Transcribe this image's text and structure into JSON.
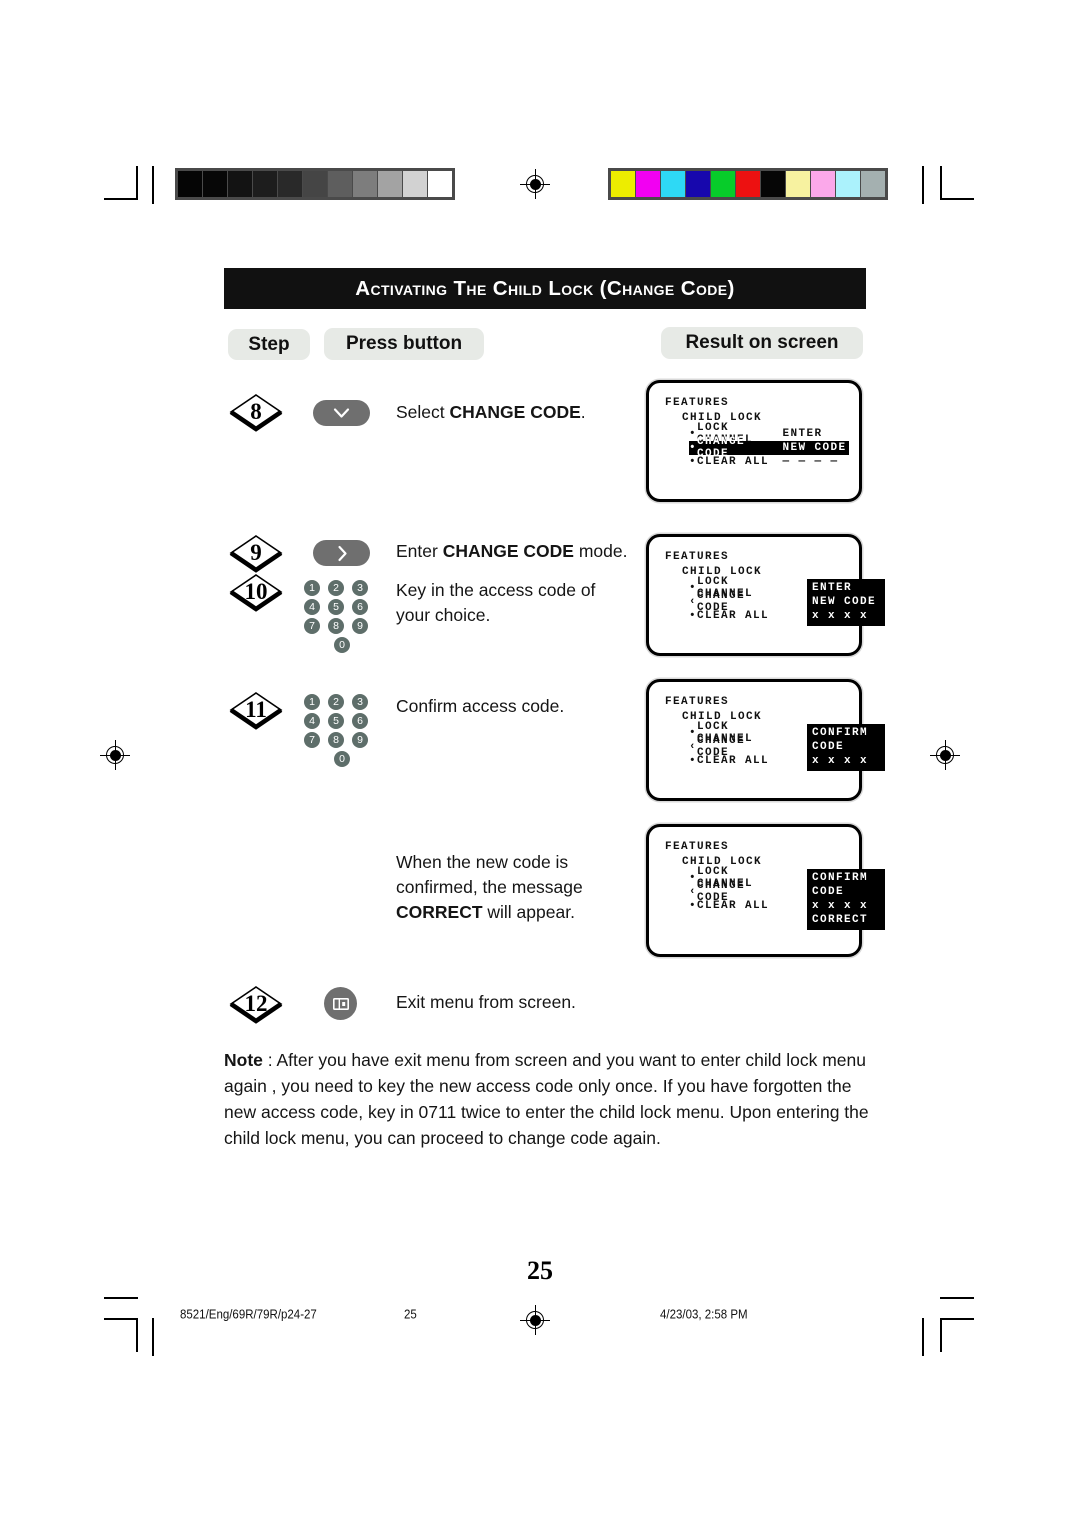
{
  "document": {
    "title": "Activating the Child Lock (Change code)",
    "page_number": "25"
  },
  "headers": {
    "step": "Step",
    "press_button": "Press button",
    "result_on_screen": "Result on screen"
  },
  "steps": [
    {
      "number": "8",
      "button": "down-arrow",
      "instruction_prefix": "Select ",
      "instruction_bold": "CHANGE CODE",
      "instruction_suffix": "."
    },
    {
      "number": "9",
      "button": "right-arrow",
      "instruction_prefix": "Enter ",
      "instruction_bold": "CHANGE CODE",
      "instruction_suffix": " mode."
    },
    {
      "number": "10",
      "button": "numeric-keypad",
      "instruction": "Key in the access code of your choice."
    },
    {
      "number": "11",
      "button": "numeric-keypad",
      "instruction": "Confirm access code."
    },
    {
      "number": "",
      "button": "none",
      "instruction_prefix": "When the new code is confirmed, the message ",
      "instruction_bold": "CORRECT",
      "instruction_suffix": " will appear."
    },
    {
      "number": "12",
      "button": "menu-exit",
      "instruction": "Exit menu from screen."
    }
  ],
  "keypad": {
    "rows": [
      [
        "1",
        "2",
        "3"
      ],
      [
        "4",
        "5",
        "6"
      ],
      [
        "7",
        "8",
        "9"
      ]
    ],
    "last_row": [
      "0"
    ]
  },
  "screens": [
    {
      "id": "screen-8",
      "heading": "FEATURES",
      "subheading": "CHILD LOCK",
      "rows": [
        {
          "bullet": "•",
          "label": "LOCK CHANNEL",
          "value": "ENTER",
          "highlight": false
        },
        {
          "bullet": "•",
          "label": "CHANGE CODE",
          "value": "NEW CODE",
          "highlight": true
        },
        {
          "bullet": "•",
          "label": "CLEAR ALL",
          "value": "— — — —",
          "highlight": false
        }
      ],
      "value_block": null
    },
    {
      "id": "screen-9-10",
      "heading": "FEATURES",
      "subheading": "CHILD LOCK",
      "rows": [
        {
          "bullet": "•",
          "label": "LOCK CHANNEL",
          "value": "",
          "highlight": false
        },
        {
          "bullet": "‹",
          "label": "CHANGE CODE",
          "value": "",
          "highlight": false
        },
        {
          "bullet": "•",
          "label": "CLEAR ALL",
          "value": "",
          "highlight": false
        }
      ],
      "value_block": [
        "ENTER",
        "NEW CODE",
        "x  x  x  x"
      ]
    },
    {
      "id": "screen-11",
      "heading": "FEATURES",
      "subheading": "CHILD LOCK",
      "rows": [
        {
          "bullet": "•",
          "label": "LOCK CHANNEL",
          "value": "",
          "highlight": false
        },
        {
          "bullet": "‹",
          "label": "CHANGE CODE",
          "value": "",
          "highlight": false
        },
        {
          "bullet": "•",
          "label": "CLEAR ALL",
          "value": "",
          "highlight": false
        }
      ],
      "value_block": [
        "CONFIRM",
        "CODE",
        "x  x  x  x"
      ]
    },
    {
      "id": "screen-correct",
      "heading": "FEATURES",
      "subheading": "CHILD LOCK",
      "rows": [
        {
          "bullet": "•",
          "label": "LOCK CHANNEL",
          "value": "",
          "highlight": false
        },
        {
          "bullet": "‹",
          "label": "CHANGE CODE",
          "value": "",
          "highlight": false
        },
        {
          "bullet": "•",
          "label": "CLEAR ALL",
          "value": "",
          "highlight": false
        }
      ],
      "value_block": [
        "CONFIRM",
        "CODE",
        "x  x  x  x",
        "CORRECT"
      ]
    }
  ],
  "note": {
    "label": "Note",
    "text": " :  After you have exit menu from screen and  you want to enter child lock menu again , you need to key the new access code only once. If you have forgotten the new access code, key in 0711 twice to enter the child lock menu. Upon entering the child lock menu, you can proceed to change code again."
  },
  "footer": {
    "job": "8521/Eng/69R/79R/p24-27",
    "page": "25",
    "timestamp": "4/23/03, 2:58 PM"
  },
  "print_marks": {
    "grayscale_swatches": [
      "#050505",
      "#070707",
      "#131313",
      "#1d1d1d",
      "#292929",
      "#454545",
      "#5e5e5e",
      "#7d7d7d",
      "#a3a3a3",
      "#d2d2d2",
      "#ffffff"
    ],
    "color_swatches": [
      "#eded00",
      "#f200f2",
      "#2ed9f5",
      "#1707ad",
      "#07cc2a",
      "#ed1111",
      "#060606",
      "#f7f2a0",
      "#fba8ea",
      "#abf2fc",
      "#a4b0b0"
    ]
  }
}
